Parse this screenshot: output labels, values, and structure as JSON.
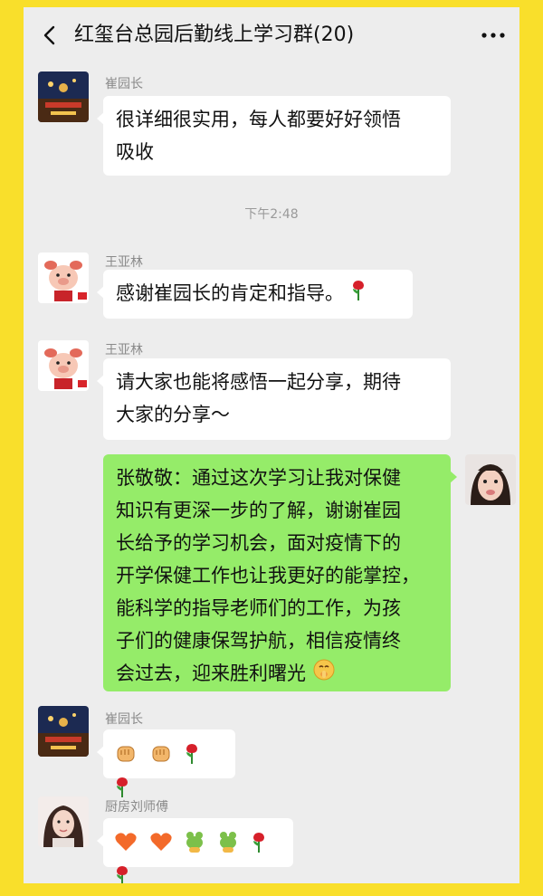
{
  "header": {
    "title": "红玺台总园后勤线上学习群(20)",
    "back_icon": "chevron-left-icon",
    "more_icon": "more-dots-icon"
  },
  "messages": [
    {
      "sender": "崔园长",
      "text": "很详细很实用，每人都要好好领悟吸收",
      "lines": [
        "很详细很实用，每人都要好好领悟",
        "吸收"
      ]
    },
    {
      "sender": "王亚林",
      "text": "感谢崔园长的肯定和指导。",
      "emoji": [
        "rose"
      ]
    },
    {
      "sender": "王亚林",
      "text": "请大家也能将感悟一起分享，期待大家的分享～",
      "lines": [
        "请大家也能将感悟一起分享，期待",
        "大家的分享～"
      ]
    },
    {
      "sender": "张敬敬",
      "self": true,
      "text": "张敬敬：通过这次学习让我对保健知识有更深一步的了解，谢谢崔园长给予的学习机会，面对疫情下的开学保健工作也让我更好的能掌控，能科学的指导老师们的工作，为孩子们的健康保驾护航，相信疫情终会过去，迎来胜利曙光",
      "lines": [
        "张敬敬：通过这次学习让我对保健",
        "知识有更深一步的了解，谢谢崔园",
        "长给予的学习机会，面对疫情下的",
        "开学保健工作也让我更好的能掌控，",
        "能科学的指导老师们的工作，为孩",
        "子们的健康保驾护航，相信疫情终",
        "会过去，迎来胜利曙光"
      ],
      "emoji": [
        "shushing-face"
      ]
    },
    {
      "sender": "崔园长",
      "emoji": [
        "fist",
        "fist",
        "rose",
        "rose"
      ]
    },
    {
      "sender": "厨房刘师傅",
      "emoji": [
        "heart",
        "heart",
        "frog",
        "frog",
        "rose",
        "rose"
      ]
    }
  ],
  "timestamp": "下午2:48",
  "colors": {
    "frame": "#f9df2b",
    "chat_bg": "#ededed",
    "self_bubble": "#95ec69",
    "other_bubble": "#ffffff"
  }
}
